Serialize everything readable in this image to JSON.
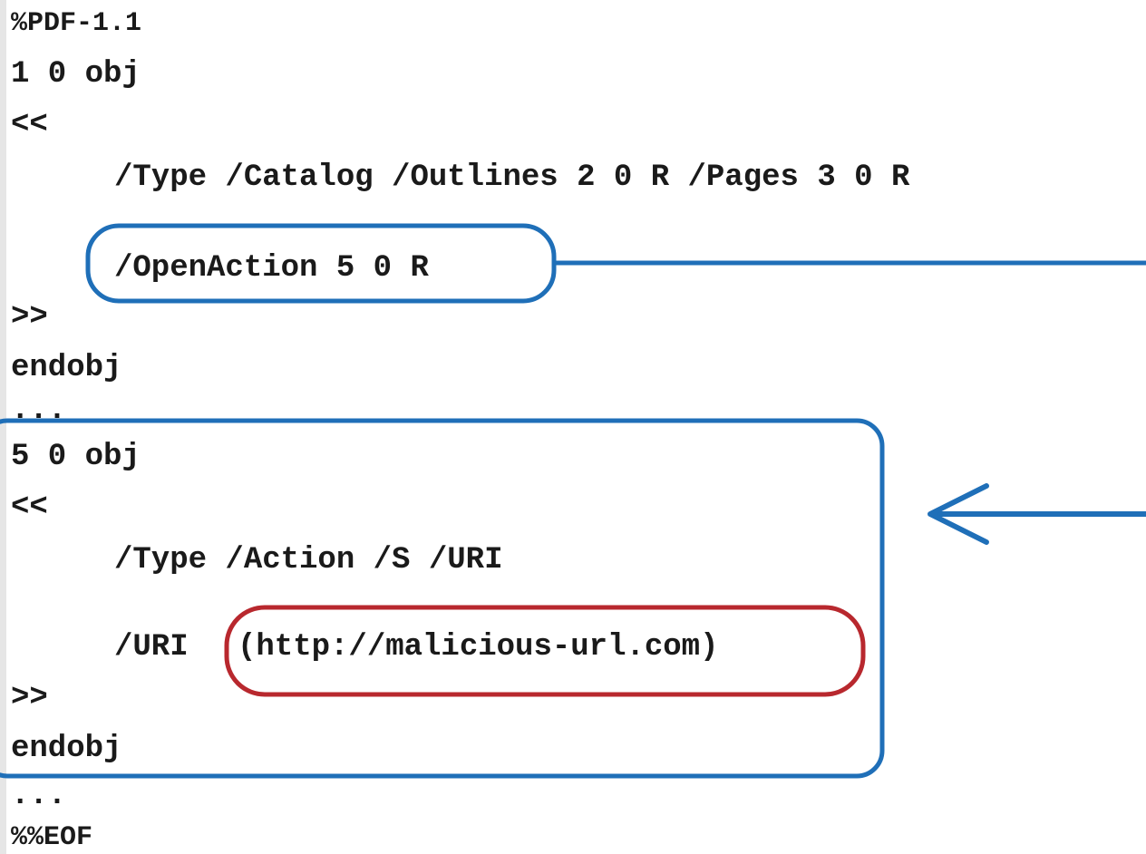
{
  "code": {
    "header": "%PDF-1.1",
    "obj1_start": "1 0 obj",
    "obj1_open": "<<",
    "obj1_type_line": "/Type /Catalog /Outlines 2 0 R /Pages 3 0 R",
    "obj1_open_action": "/OpenAction 5 0 R",
    "obj1_close": ">>",
    "obj1_end": "endobj",
    "ellipsis_1": "...",
    "obj5_start": "5 0 obj",
    "obj5_open": "<<",
    "obj5_type_line": "/Type /Action /S /URI",
    "obj5_uri_key": "/URI",
    "obj5_uri_value": "(http://malicious-url.com)",
    "obj5_close": ">>",
    "obj5_end": "endobj",
    "ellipsis_2": "...",
    "footer": "%%EOF"
  },
  "colors": {
    "highlight_blue": "#1f6fb8",
    "highlight_red": "#b8282e",
    "gutter": "#e6e6e6"
  }
}
